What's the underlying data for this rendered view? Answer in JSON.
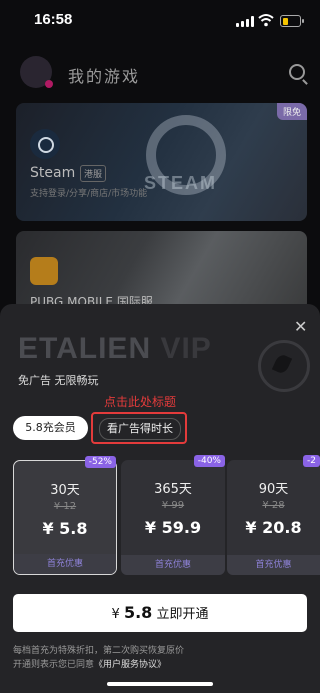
{
  "status": {
    "time": "16:58"
  },
  "header": {
    "title": "我的游戏"
  },
  "games": [
    {
      "name": "Steam",
      "tag": "港服",
      "desc": "支持登录/分享/商店/市场功能",
      "badge": "限免",
      "watermark": "STEAM"
    },
    {
      "name": "PUBG MOBILE",
      "tag": "国际服"
    }
  ],
  "sheet": {
    "title_main": "ETALIEN",
    "title_vip": "VIP",
    "subtitle": "免广告  无限畅玩",
    "annotation": "点击此处标题",
    "tabs": [
      {
        "label": "5.8充会员"
      },
      {
        "label": "看广告得时长"
      }
    ],
    "plans": [
      {
        "discount": "-52%",
        "name": "30天",
        "original": "¥ 12",
        "price": "¥ 5.8",
        "footer": "首充优惠"
      },
      {
        "discount": "-40%",
        "name": "365天",
        "original": "¥ 99",
        "price": "¥ 59.9",
        "footer": "首充优惠"
      },
      {
        "discount": "-2",
        "name": "90天",
        "original": "¥ 28",
        "price": "¥ 20.8",
        "footer": "首充优惠"
      }
    ],
    "cta": {
      "currency": "¥",
      "amount": "5.8",
      "label": "立即开通"
    },
    "terms": {
      "line1": "每档首充为特殊折扣，第二次购买恢复原价",
      "line2": "开通则表示您已同意",
      "link": "《用户服务协议》"
    }
  },
  "colors": {
    "accent": "#8a63e6",
    "annotation": "#e33b3b",
    "battery": "#f5c400"
  }
}
